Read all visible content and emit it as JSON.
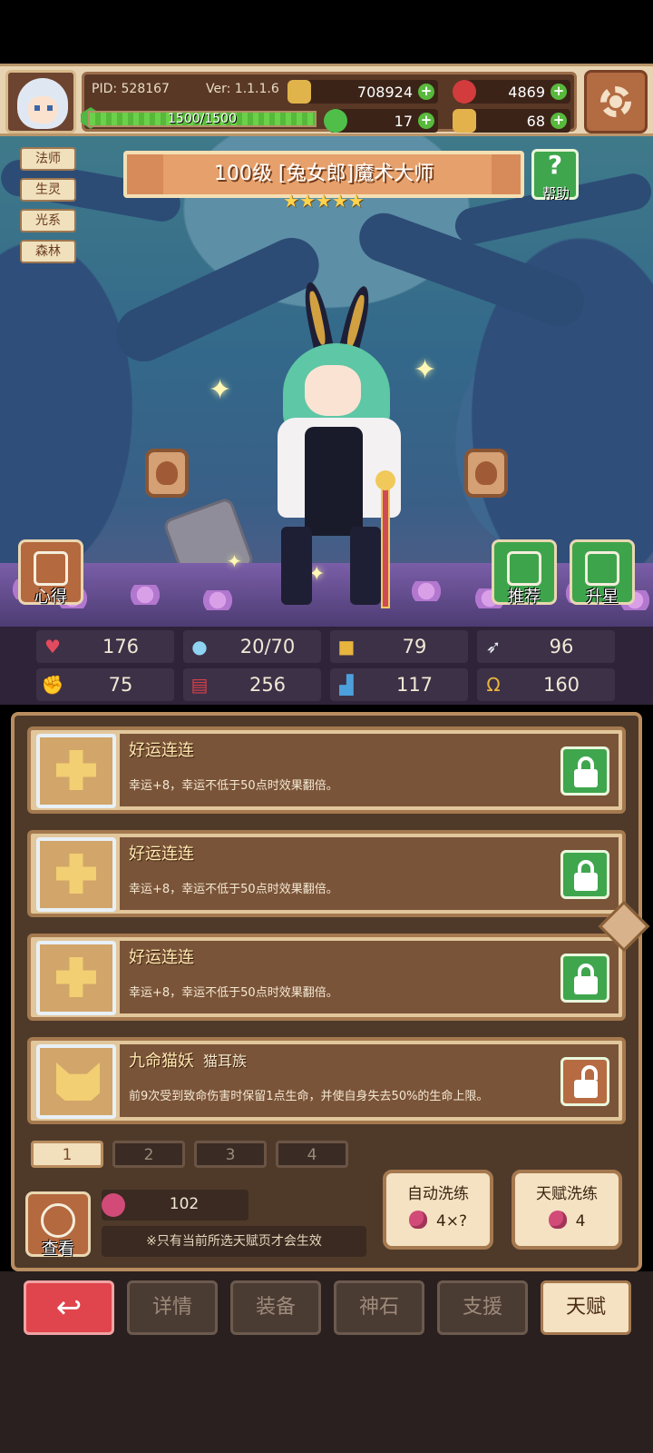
{
  "header": {
    "pid": "PID: 528167",
    "version": "Ver: 1.1.1.6",
    "xp": "1500/1500",
    "xp_fraction": 1.0,
    "resources": [
      {
        "name": "gold",
        "icon": "coin-icon",
        "value": "708924",
        "color": "#e0b44a"
      },
      {
        "name": "gems",
        "icon": "red-gem-icon",
        "value": "4869",
        "color": "#d23c3c"
      },
      {
        "name": "clover",
        "icon": "clover-icon",
        "value": "17",
        "color": "#4fbf4a"
      },
      {
        "name": "stamina",
        "icon": "arm-icon",
        "value": "68",
        "color": "#e4b24a"
      }
    ]
  },
  "tags": [
    "法师",
    "生灵",
    "光系",
    "森林"
  ],
  "character": {
    "title": "100级 [兔女郎]魔术大师",
    "stars": 5
  },
  "buttons": {
    "help": "帮助",
    "notes": "心得",
    "recommend": "推荐",
    "star_up": "升星"
  },
  "stats": [
    {
      "icon": "heart-icon",
      "value": "176"
    },
    {
      "icon": "water-drop-icon",
      "value": "20/70"
    },
    {
      "icon": "shield-icon",
      "value": "79"
    },
    {
      "icon": "wing-icon",
      "value": "96"
    },
    {
      "icon": "fist-icon",
      "value": "75"
    },
    {
      "icon": "book-icon",
      "value": "256"
    },
    {
      "icon": "boot-icon",
      "value": "117"
    },
    {
      "icon": "horseshoe-icon",
      "value": "160"
    }
  ],
  "talents": [
    {
      "name": "好运连连",
      "sub": "",
      "desc": "幸运+8，幸运不低于50点时效果翻倍。",
      "locked": true
    },
    {
      "name": "好运连连",
      "sub": "",
      "desc": "幸运+8，幸运不低于50点时效果翻倍。",
      "locked": true
    },
    {
      "name": "好运连连",
      "sub": "",
      "desc": "幸运+8，幸运不低于50点时效果翻倍。",
      "locked": true
    },
    {
      "name": "九命猫妖",
      "sub": "猫耳族",
      "desc": "前9次受到致命伤害时保留1点生命，并使自身失去50%的生命上限。",
      "locked": false
    }
  ],
  "pages": [
    "1",
    "2",
    "3",
    "4"
  ],
  "active_page": 0,
  "bottom": {
    "view_label": "查看",
    "fruit_count": "102",
    "note": "※只有当前所选天赋页才会生效",
    "auto_wash": {
      "label": "自动洗练",
      "cost": "4×?"
    },
    "talent_wash": {
      "label": "天赋洗练",
      "cost": "4"
    }
  },
  "nav": [
    "详情",
    "装备",
    "神石",
    "支援",
    "天赋"
  ],
  "nav_active": 4
}
